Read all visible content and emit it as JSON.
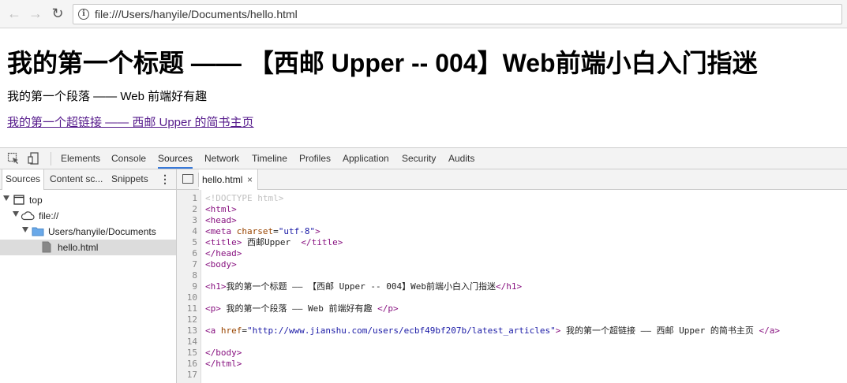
{
  "browser": {
    "url": "file:///Users/hanyile/Documents/hello.html"
  },
  "page": {
    "h1": "我的第一个标题 —— 【西邮 Upper -- 004】Web前端小白入门指迷",
    "p": "我的第一个段落 —— Web 前端好有趣",
    "link": "我的第一个超链接 —— 西邮 Upper 的简书主页"
  },
  "devtools": {
    "tabs": [
      "Elements",
      "Console",
      "Sources",
      "Network",
      "Timeline",
      "Profiles",
      "Application",
      "Security",
      "Audits"
    ],
    "active_tab": "Sources",
    "sidebar_tabs": [
      "Sources",
      "Content sc...",
      "Snippets"
    ],
    "tree": [
      "top",
      "file://",
      "Users/hanyile/Documents",
      "hello.html"
    ],
    "open_file": "hello.html",
    "line_numbers": [
      "1",
      "2",
      "3",
      "4",
      "5",
      "6",
      "7",
      "8",
      "9",
      "10",
      "11",
      "12",
      "13",
      "14",
      "15",
      "16",
      "17"
    ],
    "code": {
      "l1": "<!DOCTYPE html>",
      "l2": "<html>",
      "l3": "<head>",
      "l4_tag": "<meta",
      "l4_attr": " charset",
      "l4_eq": "=",
      "l4_val": "\"utf-8\"",
      "l4_end": ">",
      "l5_open": "<title>",
      "l5_text": " 西邮Upper  ",
      "l5_close": "</title>",
      "l6": "</head>",
      "l7": "<body>",
      "l9_open": "<h1>",
      "l9_text": "我的第一个标题 —— 【西邮 Upper -- 004】Web前端小白入门指迷",
      "l9_close": "</h1>",
      "l11_open": "<p>",
      "l11_text": " 我的第一个段落 —— Web 前端好有趣 ",
      "l11_close": "</p>",
      "l13_tag": "<a",
      "l13_attr": " href",
      "l13_eq": "=",
      "l13_val": "\"http://www.jianshu.com/users/ecbf49bf207b/latest_articles\"",
      "l13_gt": ">",
      "l13_text": " 我的第一个超链接 —— 西邮 Upper 的简书主页 ",
      "l13_close": "</a>",
      "l15": "</body>",
      "l16": "</html>"
    }
  }
}
